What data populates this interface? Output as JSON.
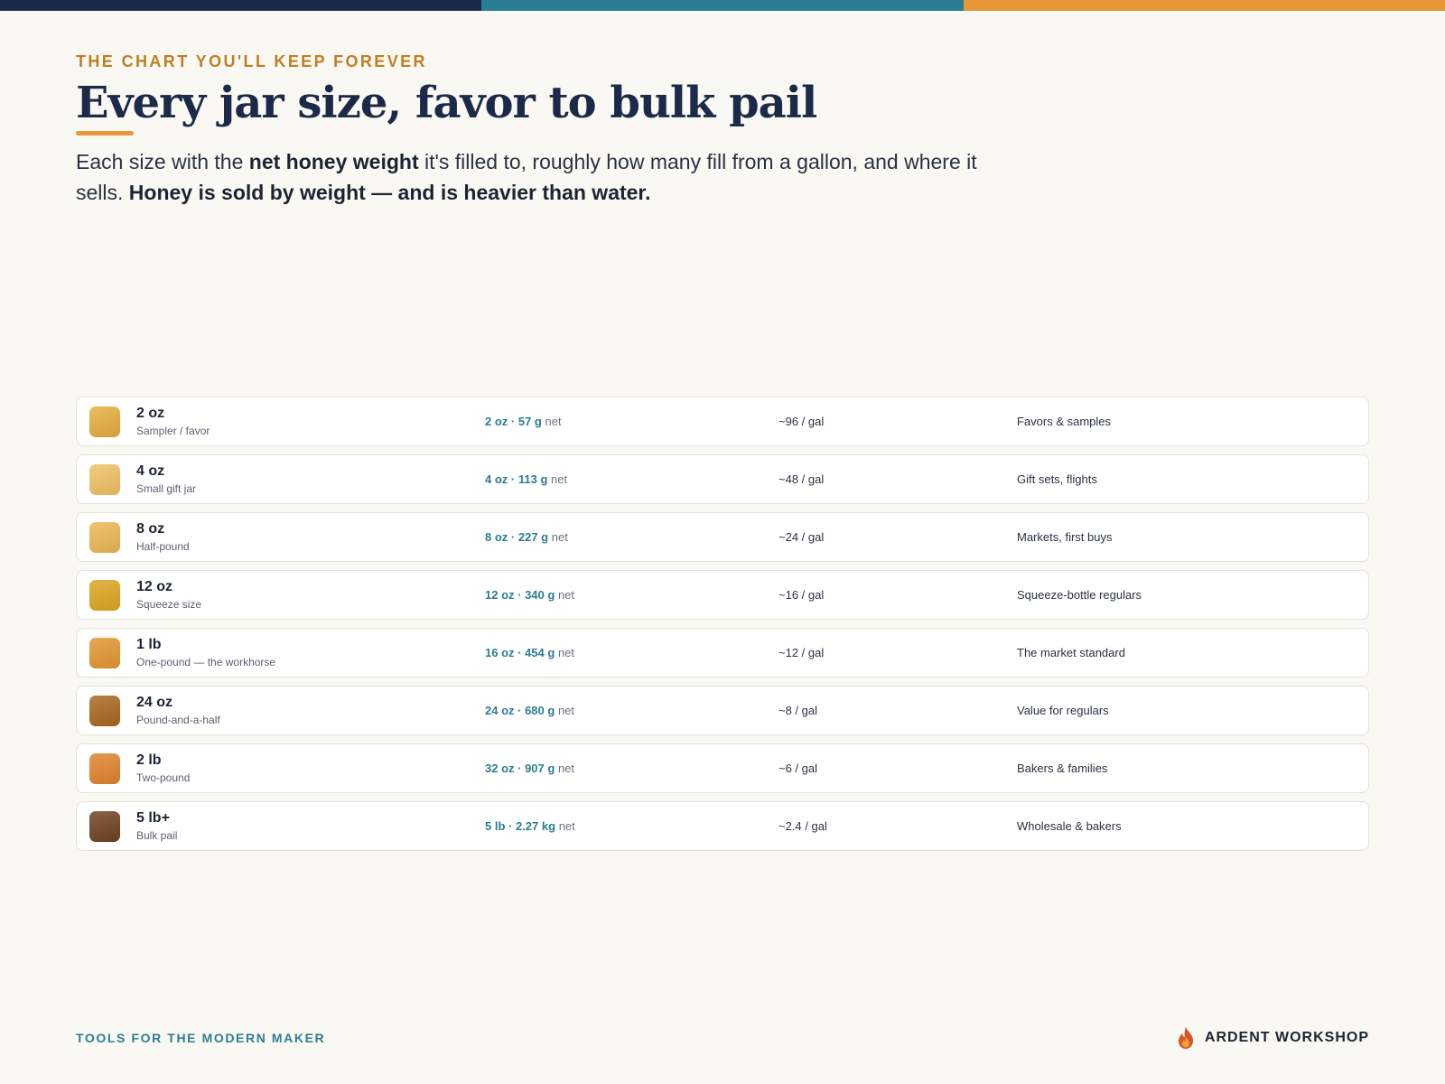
{
  "colors": {
    "navy": "#1c2a4a",
    "teal": "#2b7d93",
    "orange": "#e8963a",
    "gold": "#c07e22",
    "background": "#faf8f2"
  },
  "header": {
    "eyebrow": "THE CHART YOU'LL KEEP FOREVER",
    "title": "Every jar size, favor to bulk pail",
    "lede": {
      "p1": "Each size with the ",
      "b1": "net honey weight",
      "p2": " it's filled to, roughly how many fill from a gallon, and where it sells. ",
      "b2": "Honey is sold by weight — and is heavier than water."
    }
  },
  "jar_sizes": [
    {
      "size": "2 oz",
      "subtitle": "Sampler / favor",
      "weight_oz": "2 oz",
      "weight_metric": "57 g",
      "net": "net",
      "per_gallon": "~96 / gal",
      "use": "Favors & samples",
      "swatch_color": "#e4ad3c"
    },
    {
      "size": "4 oz",
      "subtitle": "Small gift jar",
      "weight_oz": "4 oz",
      "weight_metric": "113 g",
      "net": "net",
      "per_gallon": "~48 / gal",
      "use": "Gift sets, flights",
      "swatch_color": "#efc062"
    },
    {
      "size": "8 oz",
      "subtitle": "Half-pound",
      "weight_oz": "8 oz",
      "weight_metric": "227 g",
      "net": "net",
      "per_gallon": "~24 / gal",
      "use": "Markets, first buys",
      "swatch_color": "#ebb752"
    },
    {
      "size": "12 oz",
      "subtitle": "Squeeze size",
      "weight_oz": "12 oz",
      "weight_metric": "340 g",
      "net": "net",
      "per_gallon": "~16 / gal",
      "use": "Squeeze-bottle regulars",
      "swatch_color": "#dca421"
    },
    {
      "size": "1 lb",
      "subtitle": "One-pound — the workhorse",
      "weight_oz": "16 oz",
      "weight_metric": "454 g",
      "net": "net",
      "per_gallon": "~12 / gal",
      "use": "The market standard",
      "swatch_color": "#e39530"
    },
    {
      "size": "24 oz",
      "subtitle": "Pound-and-a-half",
      "weight_oz": "24 oz",
      "weight_metric": "680 g",
      "net": "net",
      "per_gallon": "~8 / gal",
      "use": "Value for regulars",
      "swatch_color": "#a8661e"
    },
    {
      "size": "2 lb",
      "subtitle": "Two-pound",
      "weight_oz": "32 oz",
      "weight_metric": "907 g",
      "net": "net",
      "per_gallon": "~6 / gal",
      "use": "Bakers & families",
      "swatch_color": "#e0822b"
    },
    {
      "size": "5 lb+",
      "subtitle": "Bulk pail",
      "weight_oz": "5 lb",
      "weight_metric": "2.27 kg",
      "net": "net",
      "per_gallon": "~2.4 / gal",
      "use": "Wholesale & bakers",
      "swatch_color": "#6f4020"
    }
  ],
  "footer": {
    "tagline": "TOOLS FOR THE MODERN MAKER",
    "brand": "ARDENT WORKSHOP",
    "brand_icon": "flame-icon"
  }
}
